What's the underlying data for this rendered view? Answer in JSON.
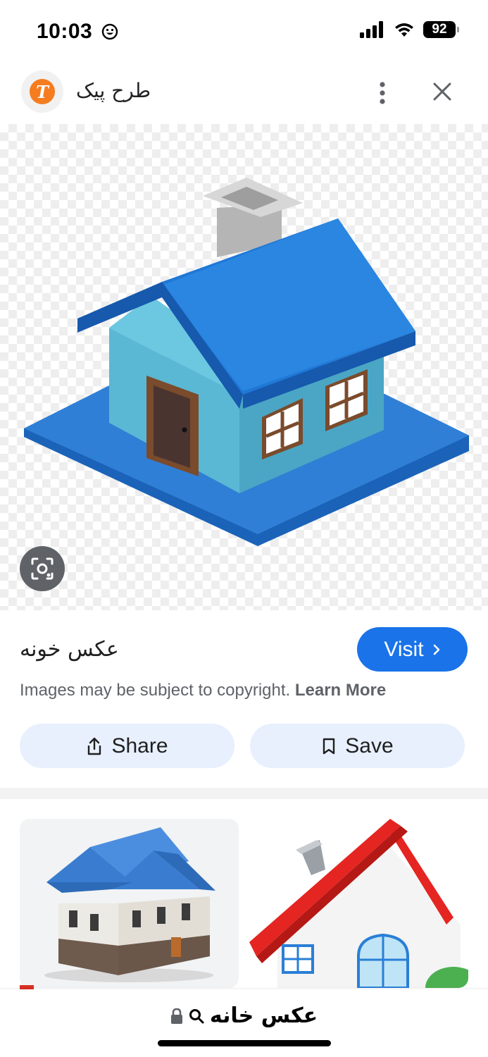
{
  "status_bar": {
    "time": "10:03",
    "battery": "92"
  },
  "header": {
    "site_name": "طرح پیک",
    "logo_letter": "T"
  },
  "result": {
    "title": "عکس خونه",
    "visit_label": "Visit",
    "copyright_text": "Images may be subject to copyright.",
    "learn_more_label": "Learn More",
    "share_label": "Share",
    "save_label": "Save"
  },
  "address_bar": {
    "url_text": "عکس خانه"
  },
  "colors": {
    "accent": "#1a73e8",
    "pill_bg": "#e8f0fe",
    "house_roof": "#1f78d6",
    "house_wall": "#5bb8d4",
    "site_logo": "#f57c1f"
  },
  "icons": [
    "smiley-icon",
    "signal-icon",
    "wifi-icon",
    "battery-icon",
    "more-vert-icon",
    "close-icon",
    "lens-icon",
    "chevron-right-icon",
    "share-icon",
    "bookmark-icon",
    "lock-icon",
    "search-icon"
  ]
}
